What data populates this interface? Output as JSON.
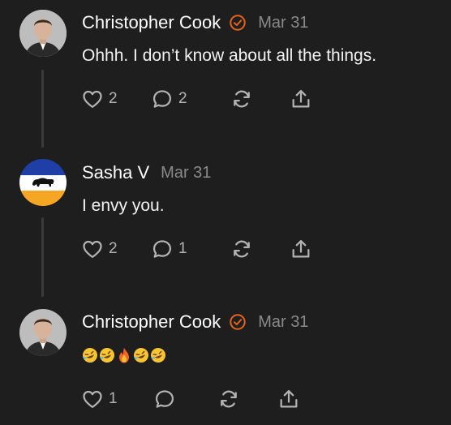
{
  "accent_color": "#e2641c",
  "posts": [
    {
      "author": "Christopher Cook",
      "verified": true,
      "date": "Mar 31",
      "text": "Ohhh. I don’t know about all the things.",
      "likes": "2",
      "replies": "2"
    },
    {
      "author": "Sasha V",
      "verified": false,
      "date": "Mar 31",
      "text": "I envy you.",
      "likes": "2",
      "replies": "1"
    },
    {
      "author": "Christopher Cook",
      "verified": true,
      "date": "Mar 31",
      "emojis": [
        "rofl",
        "rofl",
        "fire",
        "rofl",
        "rofl"
      ],
      "likes": "1",
      "replies": ""
    }
  ],
  "icons": {
    "like": "heart-icon",
    "reply": "speech-bubble-icon",
    "repost": "repost-arrows-icon",
    "share": "share-upload-icon",
    "verified": "verified-check-icon"
  }
}
